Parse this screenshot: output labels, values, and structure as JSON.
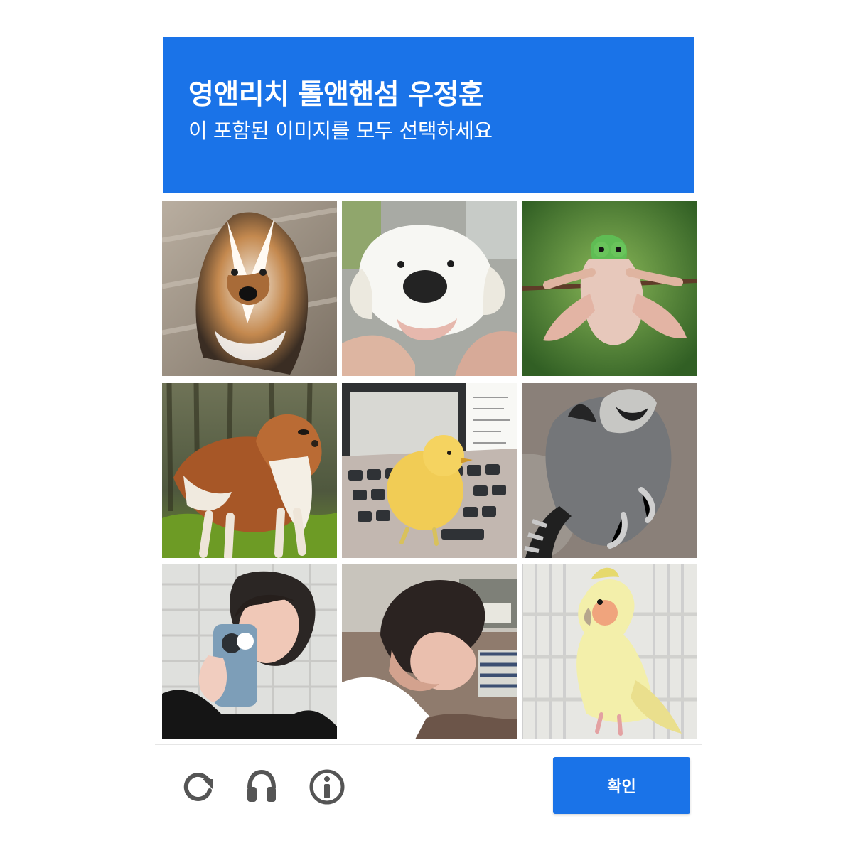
{
  "captcha": {
    "header": {
      "title": "영앤리치 톨앤핸섬 우정훈",
      "subtitle": "이 포함된 이미지를 모두 선택하세요"
    },
    "grid": [
      {
        "subject": "sheltie"
      },
      {
        "subject": "puppy"
      },
      {
        "subject": "frog"
      },
      {
        "subject": "collie"
      },
      {
        "subject": "chick-on-laptop"
      },
      {
        "subject": "raccoon"
      },
      {
        "subject": "person-mirror-selfie"
      },
      {
        "subject": "person-sleeping"
      },
      {
        "subject": "cockatiel"
      }
    ],
    "footer": {
      "icons": [
        "refresh-icon",
        "headphones-icon",
        "info-icon"
      ],
      "confirm_label": "확인"
    },
    "colors": {
      "accent": "#1a73e8",
      "divider": "#e6e6e6",
      "icon": "#555555"
    }
  }
}
